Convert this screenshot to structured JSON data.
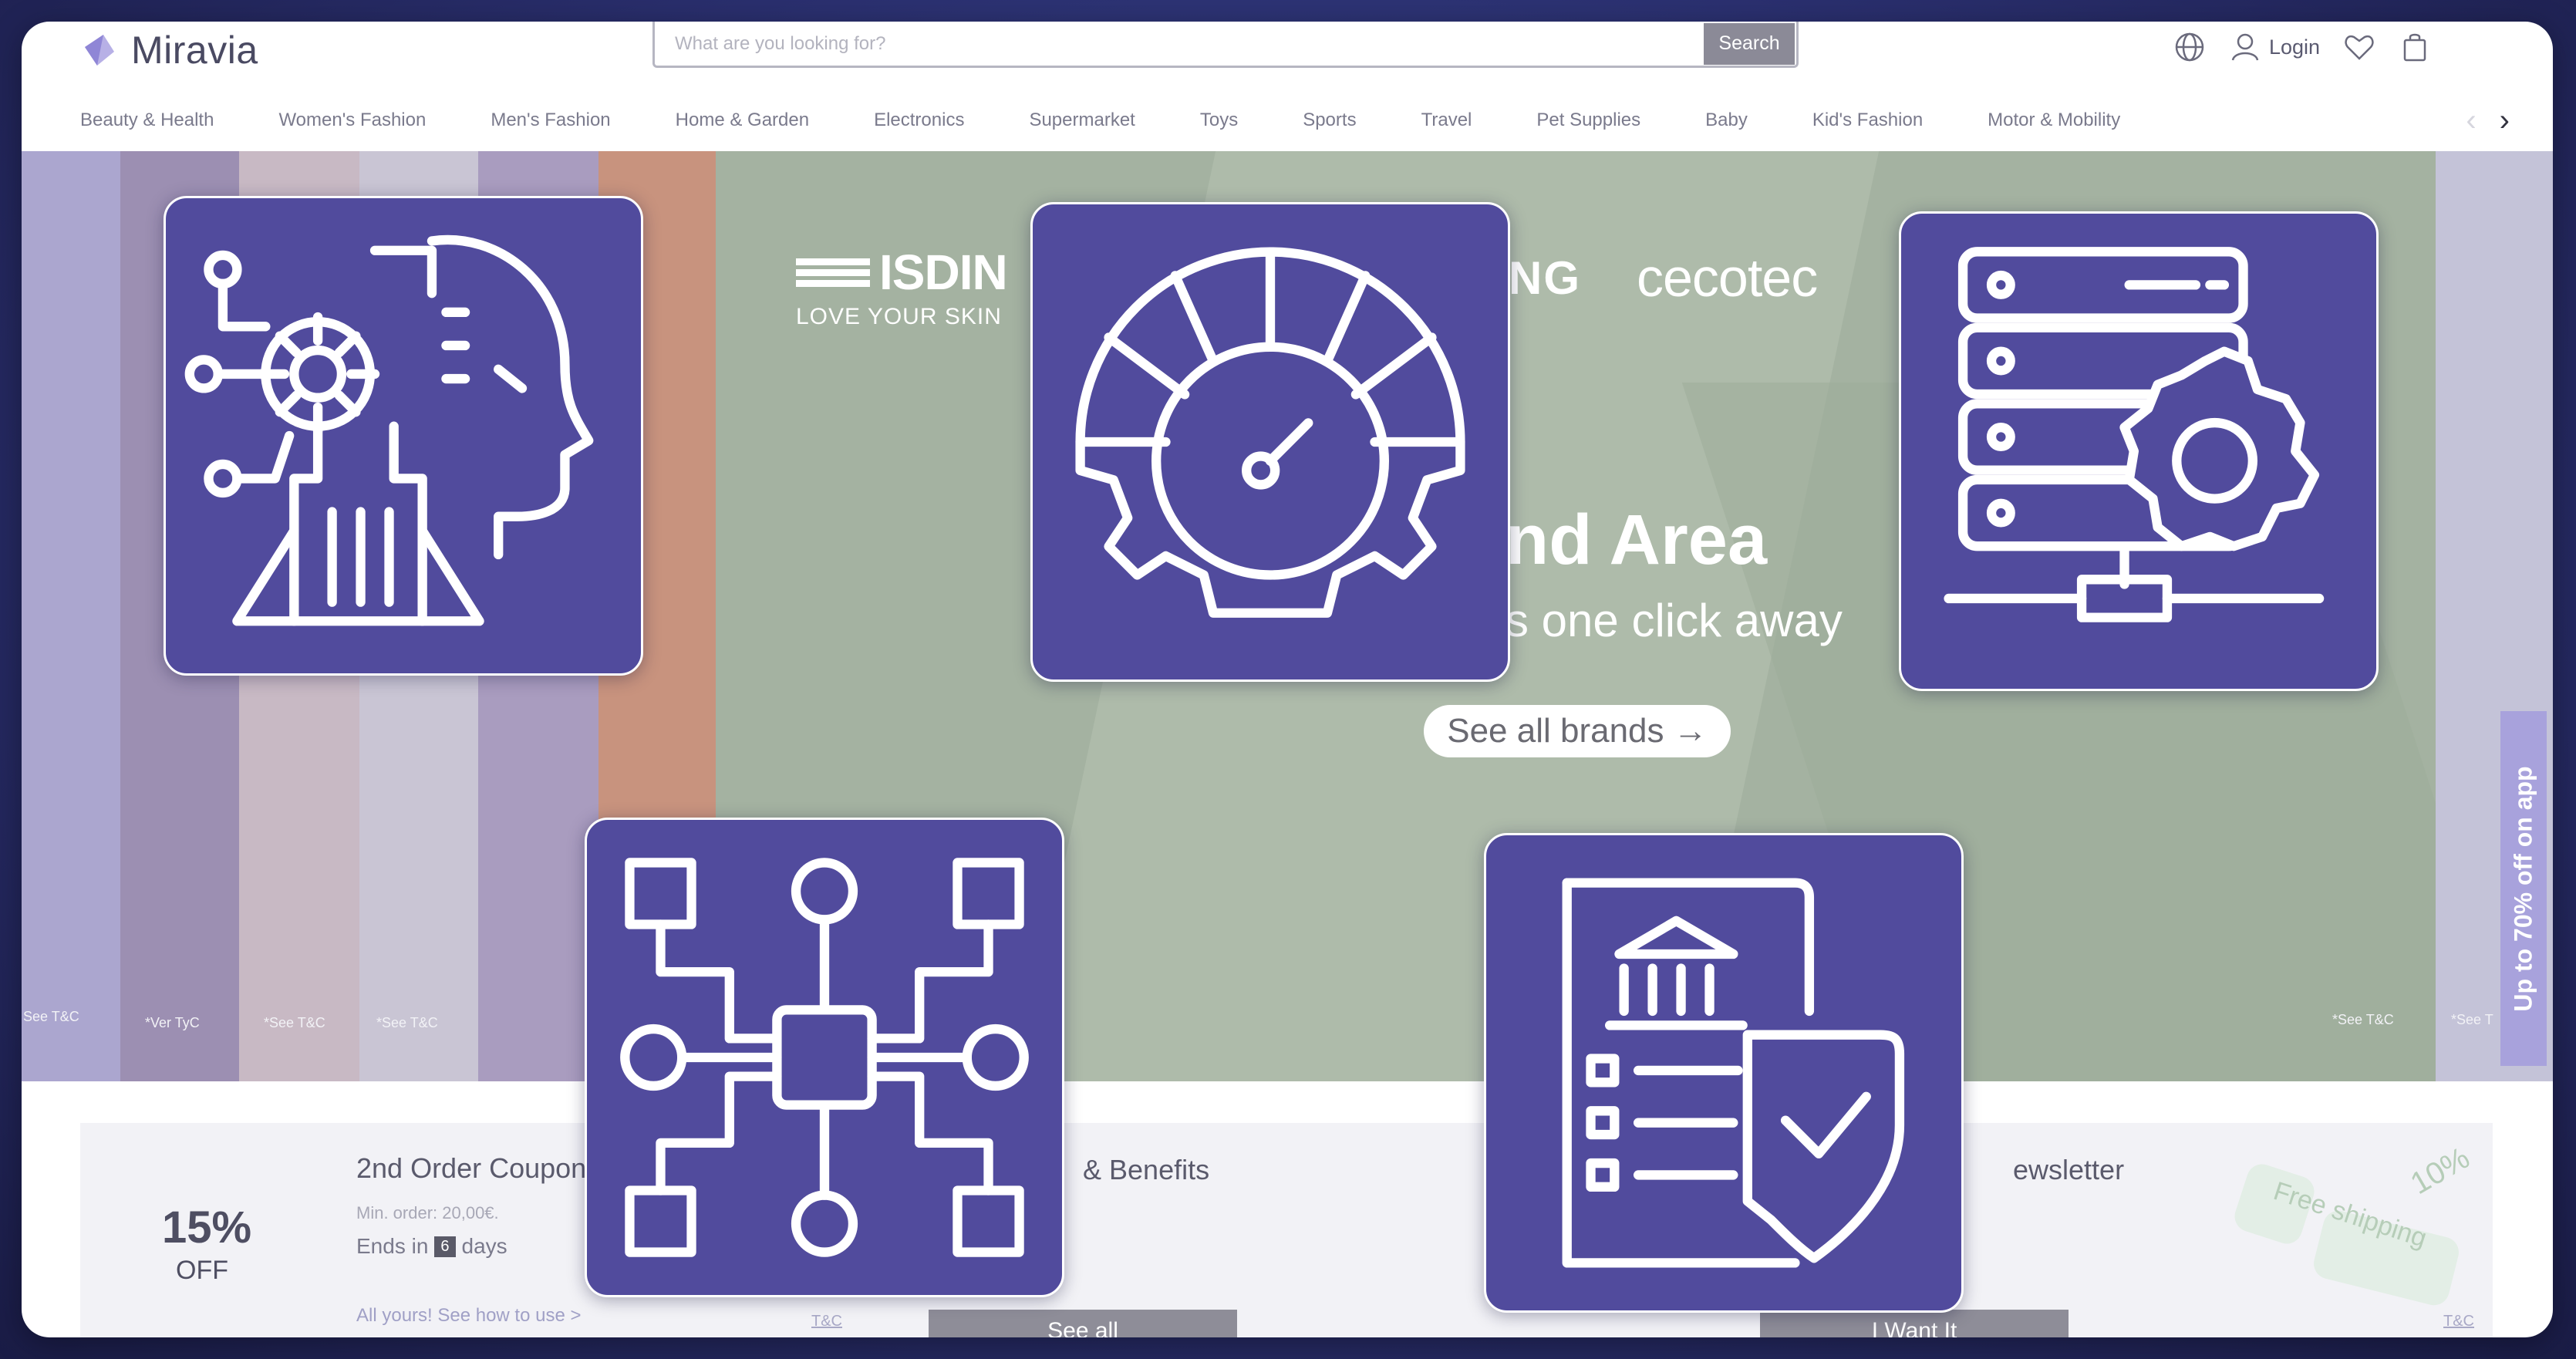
{
  "header": {
    "logo_text": "Miravia",
    "search_placeholder": "What are you looking for?",
    "search_button": "Search",
    "login_label": "Login",
    "icons": [
      "globe-icon",
      "user-icon",
      "heart-icon",
      "bag-icon"
    ]
  },
  "categories": [
    "Beauty & Health",
    "Women's Fashion",
    "Men's Fashion",
    "Home & Garden",
    "Electronics",
    "Supermarket",
    "Toys",
    "Sports",
    "Travel",
    "Pet Supplies",
    "Baby",
    "Kid's Fashion",
    "Motor & Mobility"
  ],
  "hero": {
    "brand_isdn": "ISDIN",
    "brand_isdn_tagline": "LOVE YOUR SKIN",
    "brand_partial": "NG",
    "brand_cecotec": "cecotec",
    "title_partial": "nd Area",
    "subtitle_partial": "s one click away",
    "button_label": "See all brands →",
    "tc_labels": [
      "See T&C",
      "*Ver TyC",
      "*See T&C",
      "*See T&C",
      "*See T&C",
      "*See T"
    ],
    "promo_tab": "Up to 70% off on app"
  },
  "cards": {
    "coupon": {
      "percent": "15%",
      "off": "OFF",
      "title": "2nd Order Coupon",
      "min_order": "Min. order: 20,00€.",
      "ends_prefix": "Ends in",
      "days_value": "6",
      "ends_suffix": "days",
      "link": "All yours! See how to use >",
      "tc": "T&C"
    },
    "benefits": {
      "title_partial": "& Benefits",
      "button": "See all"
    },
    "newsletter": {
      "title_partial": "ewsletter",
      "button_partial": "I Want It",
      "deco_free": "Free shipping",
      "deco_pct": "10%",
      "tc": "T&C"
    }
  },
  "overlay_tiles": [
    {
      "name": "ai-brain-circuit-icon"
    },
    {
      "name": "performance-gauge-gear-icon"
    },
    {
      "name": "server-settings-icon"
    },
    {
      "name": "network-flowchart-icon"
    },
    {
      "name": "compliance-document-shield-icon"
    }
  ],
  "colors": {
    "tile_bg": "#514b9d",
    "tile_stroke": "#ffffff",
    "hero_bg": "#a4b2a1",
    "page_bg": "#2a2f6e"
  }
}
